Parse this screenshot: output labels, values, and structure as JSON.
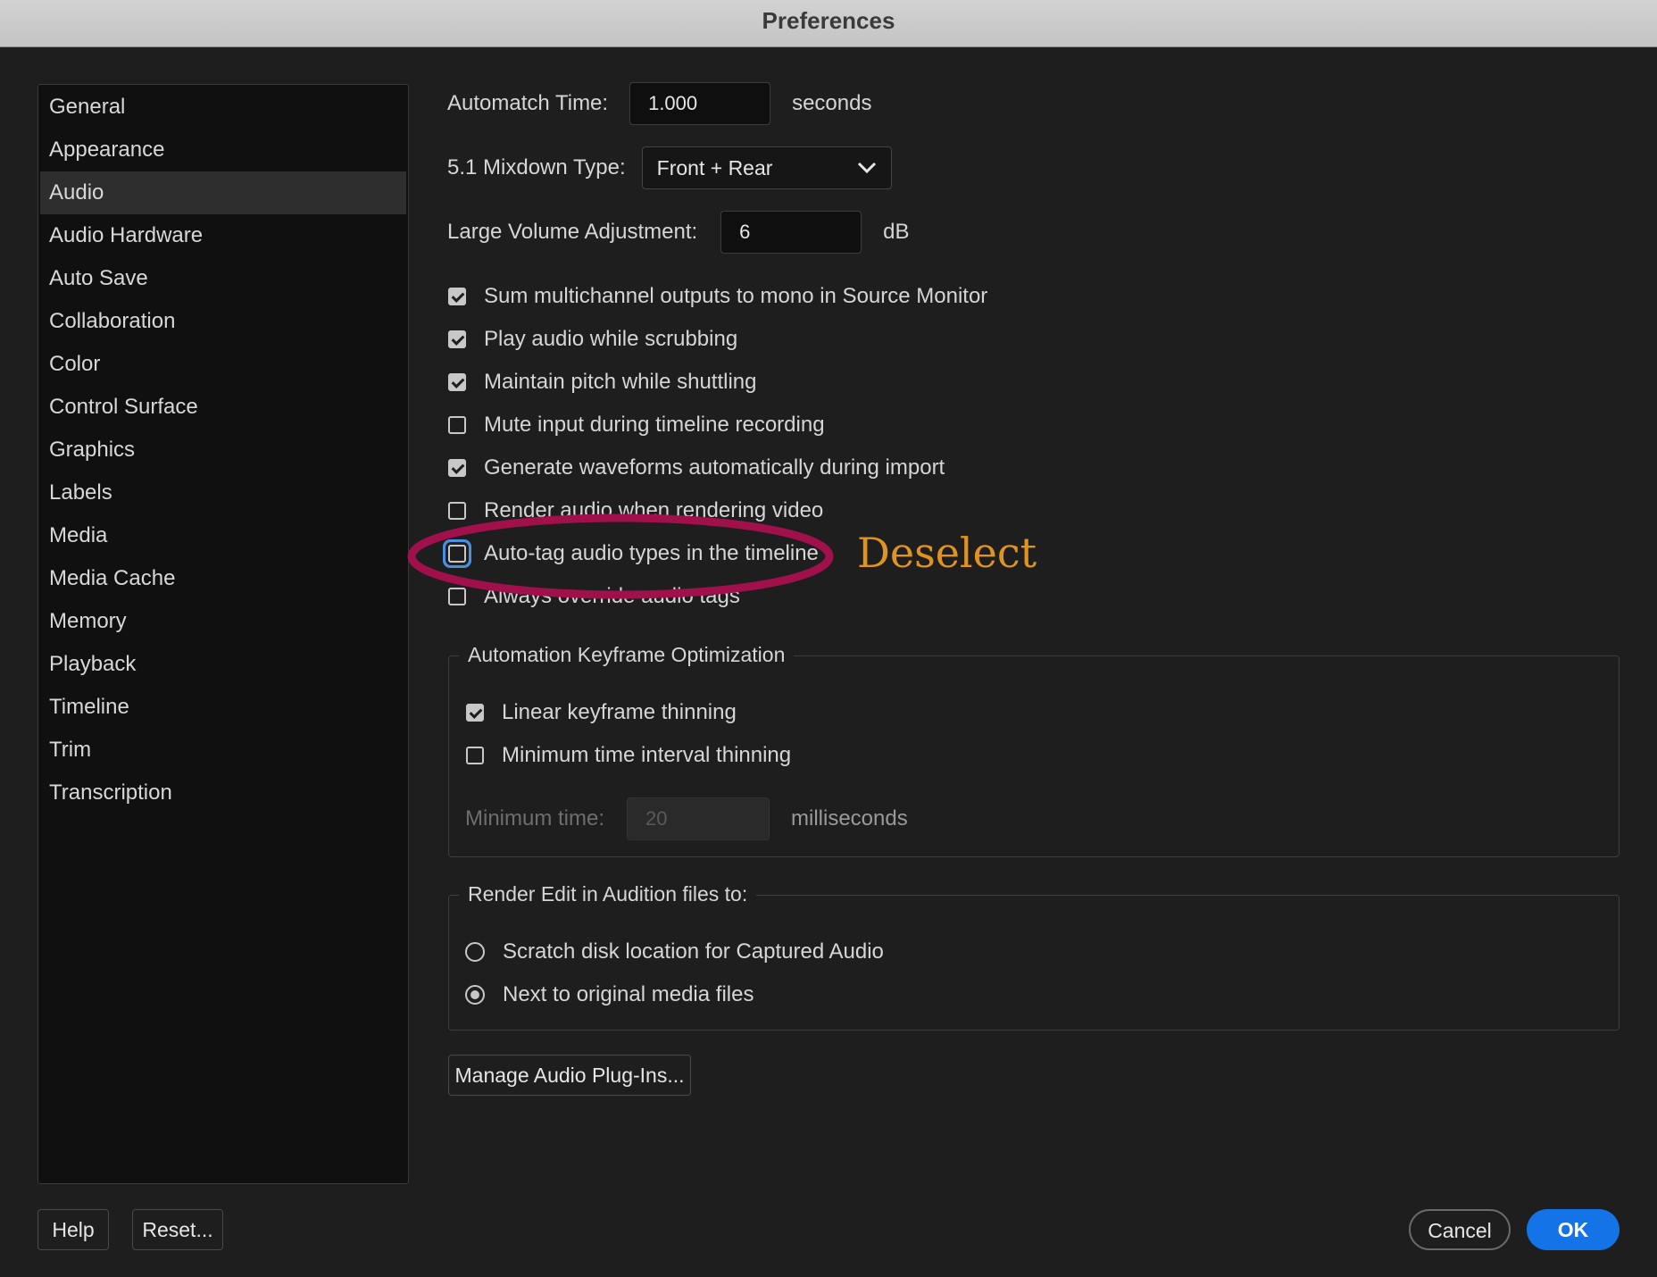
{
  "window": {
    "title": "Preferences"
  },
  "sidebar": {
    "items": [
      {
        "label": "General"
      },
      {
        "label": "Appearance"
      },
      {
        "label": "Audio"
      },
      {
        "label": "Audio Hardware"
      },
      {
        "label": "Auto Save"
      },
      {
        "label": "Collaboration"
      },
      {
        "label": "Color"
      },
      {
        "label": "Control Surface"
      },
      {
        "label": "Graphics"
      },
      {
        "label": "Labels"
      },
      {
        "label": "Media"
      },
      {
        "label": "Media Cache"
      },
      {
        "label": "Memory"
      },
      {
        "label": "Playback"
      },
      {
        "label": "Timeline"
      },
      {
        "label": "Trim"
      },
      {
        "label": "Transcription"
      }
    ],
    "selected": "Audio"
  },
  "audio": {
    "automatch": {
      "label": "Automatch Time:",
      "value": "1.000",
      "unit": "seconds"
    },
    "mixdown": {
      "label": "5.1 Mixdown Type:",
      "value": "Front + Rear"
    },
    "large_volume": {
      "label": "Large Volume Adjustment:",
      "value": "6",
      "unit": "dB"
    },
    "checkboxes": [
      {
        "label": "Sum multichannel outputs to mono in Source Monitor",
        "checked": true
      },
      {
        "label": "Play audio while scrubbing",
        "checked": true
      },
      {
        "label": "Maintain pitch while shuttling",
        "checked": true
      },
      {
        "label": "Mute input during timeline recording",
        "checked": false
      },
      {
        "label": "Generate waveforms automatically during import",
        "checked": true
      },
      {
        "label": "Render audio when rendering video",
        "checked": false
      },
      {
        "label": "Auto-tag audio types in the timeline",
        "checked": false
      },
      {
        "label": "Always override audio tags",
        "checked": false
      }
    ],
    "keyframe_group": {
      "title": "Automation Keyframe Optimization",
      "linear": {
        "label": "Linear keyframe thinning",
        "checked": true
      },
      "min_interval": {
        "label": "Minimum time interval thinning",
        "checked": false
      },
      "min_time": {
        "label": "Minimum time:",
        "value": "20",
        "unit": "milliseconds"
      }
    },
    "render_group": {
      "title": "Render Edit in Audition files to:",
      "options": [
        {
          "label": "Scratch disk location for Captured Audio",
          "selected": false
        },
        {
          "label": "Next to original media files",
          "selected": true
        }
      ]
    },
    "manage_plugins_label": "Manage Audio Plug-Ins..."
  },
  "footer": {
    "help": "Help",
    "reset": "Reset...",
    "cancel": "Cancel",
    "ok": "OK"
  },
  "annotation": {
    "text": "Deselect",
    "color": "#e19320",
    "ellipse_color": "#a0104a"
  },
  "colors": {
    "primary": "#1473e6",
    "background": "#1e1e1e"
  }
}
